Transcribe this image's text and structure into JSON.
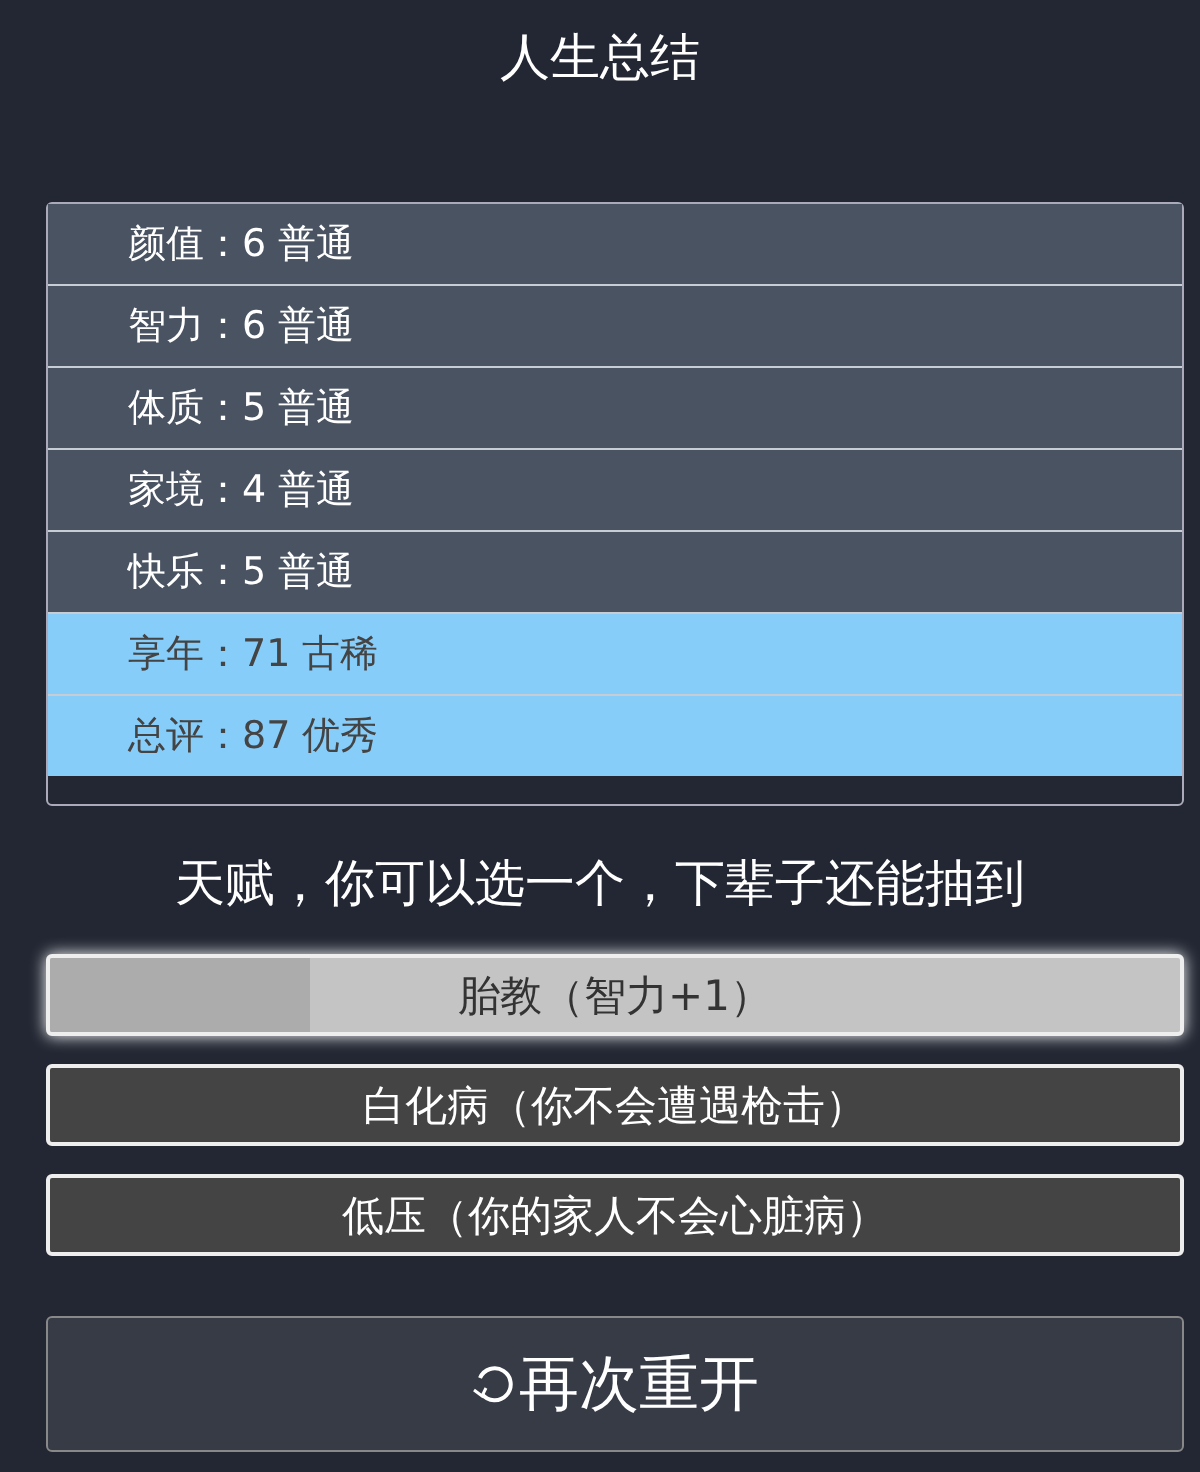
{
  "title": "人生总结",
  "stats": [
    {
      "label": "颜值：6 普通",
      "highlighted": false
    },
    {
      "label": "智力：6 普通",
      "highlighted": false
    },
    {
      "label": "体质：5 普通",
      "highlighted": false
    },
    {
      "label": "家境：4 普通",
      "highlighted": false
    },
    {
      "label": "快乐：5 普通",
      "highlighted": false
    },
    {
      "label": "享年：71 古稀",
      "highlighted": true
    },
    {
      "label": "总评：87 优秀",
      "highlighted": true
    }
  ],
  "talent_heading": "天赋，你可以选一个，下辈子还能抽到",
  "talents": [
    {
      "label": "胎教（智力+1）",
      "selected": true,
      "level": 0.23
    },
    {
      "label": "白化病（你不会遭遇枪击）",
      "selected": false
    },
    {
      "label": "低压（你的家人不会心脏病）",
      "selected": false
    }
  ],
  "restart_button": {
    "label": "再次重开"
  }
}
